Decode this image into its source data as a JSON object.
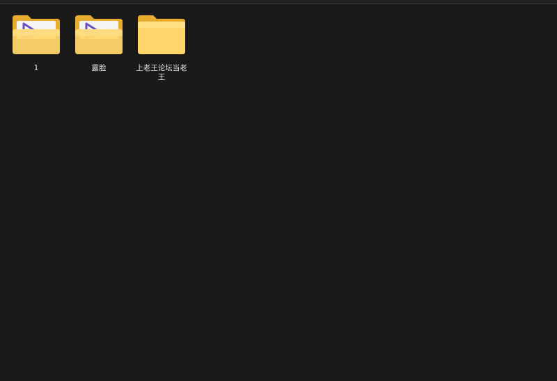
{
  "items": [
    {
      "label": "1",
      "icon": "folder-with-media-icon"
    },
    {
      "label": "露脸",
      "icon": "folder-with-media-icon"
    },
    {
      "label": "上老王论坛当老王",
      "icon": "folder-icon"
    }
  ],
  "colors": {
    "background": "#191919",
    "folder_back": "#e8b53a",
    "folder_front": "#ffd76e",
    "media_accent": "#6a4fc4"
  }
}
